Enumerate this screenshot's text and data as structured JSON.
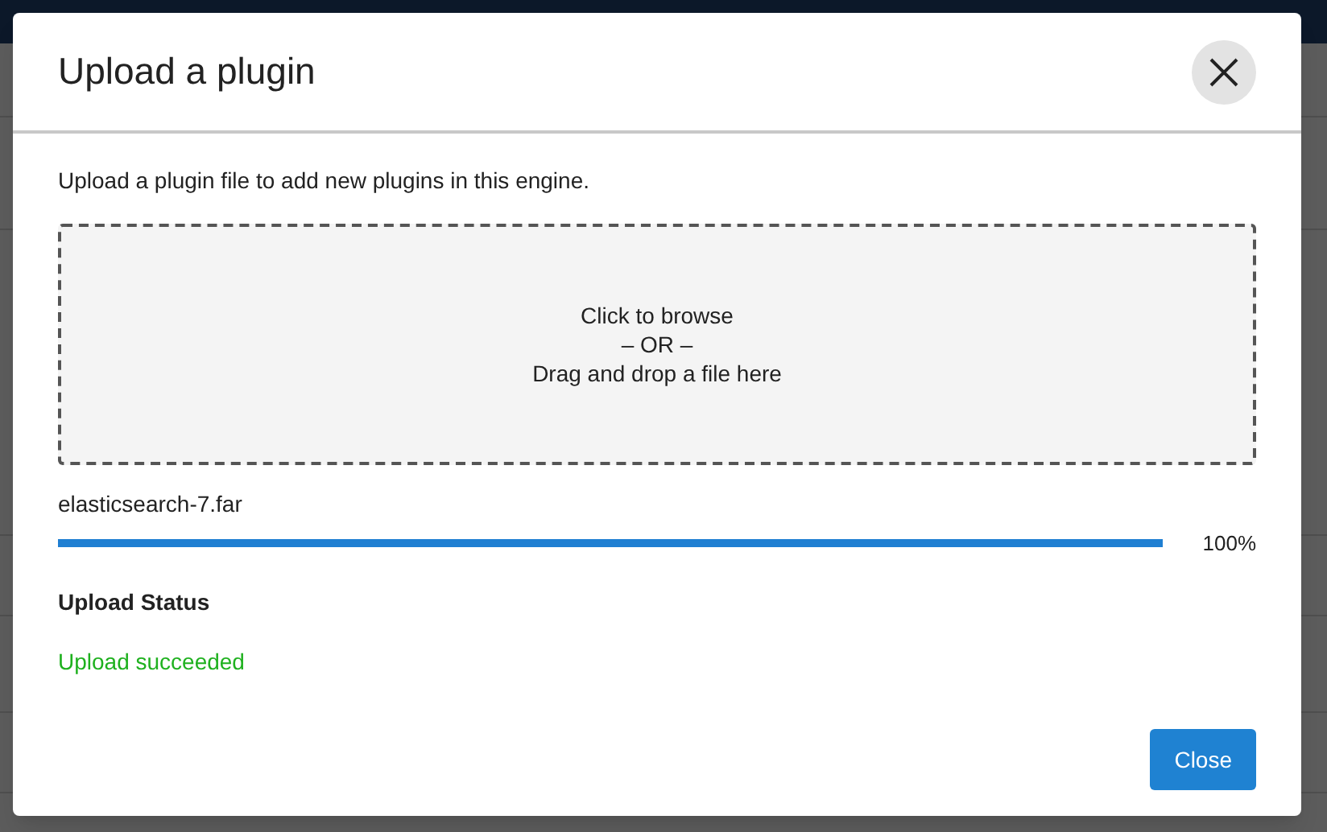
{
  "dialog": {
    "title": "Upload a plugin",
    "description": "Upload a plugin file to add new plugins in this engine.",
    "dropzone": {
      "lines": [
        "Click to browse",
        "– OR –",
        "Drag and drop a file here"
      ]
    },
    "file": {
      "name": "elasticsearch-7.far",
      "level": 1,
      "percent": "100%"
    },
    "status": {
      "heading": "Upload Status",
      "message": "Upload succeeded",
      "kind": "success"
    },
    "buttons": [
      {
        "label": "Close"
      }
    ]
  }
}
